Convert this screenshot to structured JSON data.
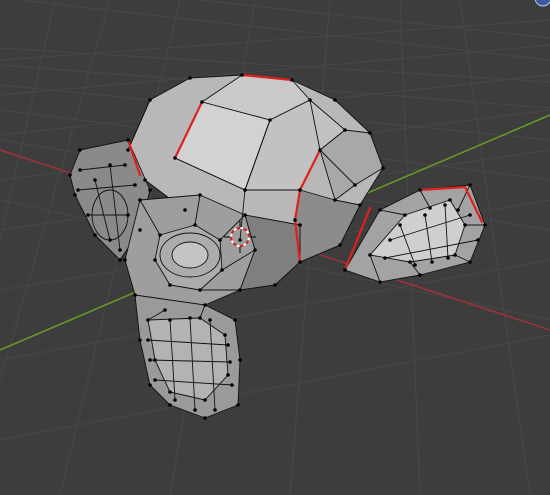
{
  "viewport": {
    "mode": "edit-mode",
    "object": "monkey-mesh",
    "background": "#3d3d3d",
    "grid_color": "#484848",
    "x_axis_color": "#a0323a",
    "y_axis_color": "#6a9a2a",
    "mesh_face_color": "#9b9b9b",
    "mesh_light_color": "#c9c9c9",
    "mesh_dark_color": "#6e6e6e",
    "wire_color": "#111111",
    "vertex_color": "#000000",
    "seam_color": "#e02020"
  },
  "corner_widget": {
    "icon": "navigation-gizmo-icon"
  },
  "cursor_3d": {
    "icon": "3d-cursor-icon"
  }
}
